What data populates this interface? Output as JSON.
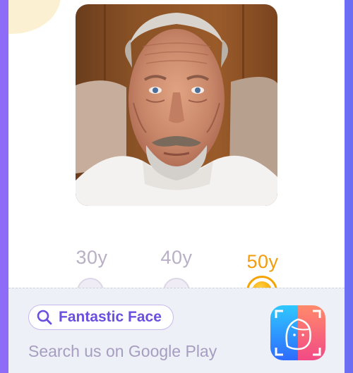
{
  "app": {
    "brand_colors": {
      "primary": "#7a67f5",
      "active": "#f5a300",
      "muted": "#b9b0c6"
    }
  },
  "photo": {
    "icon": "aged-face-photo"
  },
  "age_selector": {
    "options": [
      {
        "label": "30y",
        "selected": false
      },
      {
        "label": "40y",
        "selected": false
      },
      {
        "label": "50y",
        "selected": true
      }
    ]
  },
  "footer": {
    "search_pill_label": "Fantastic Face",
    "search_icon": "search-icon",
    "subtext": "Search us on Google Play",
    "app_icon": "fantastic-face-app-icon"
  }
}
